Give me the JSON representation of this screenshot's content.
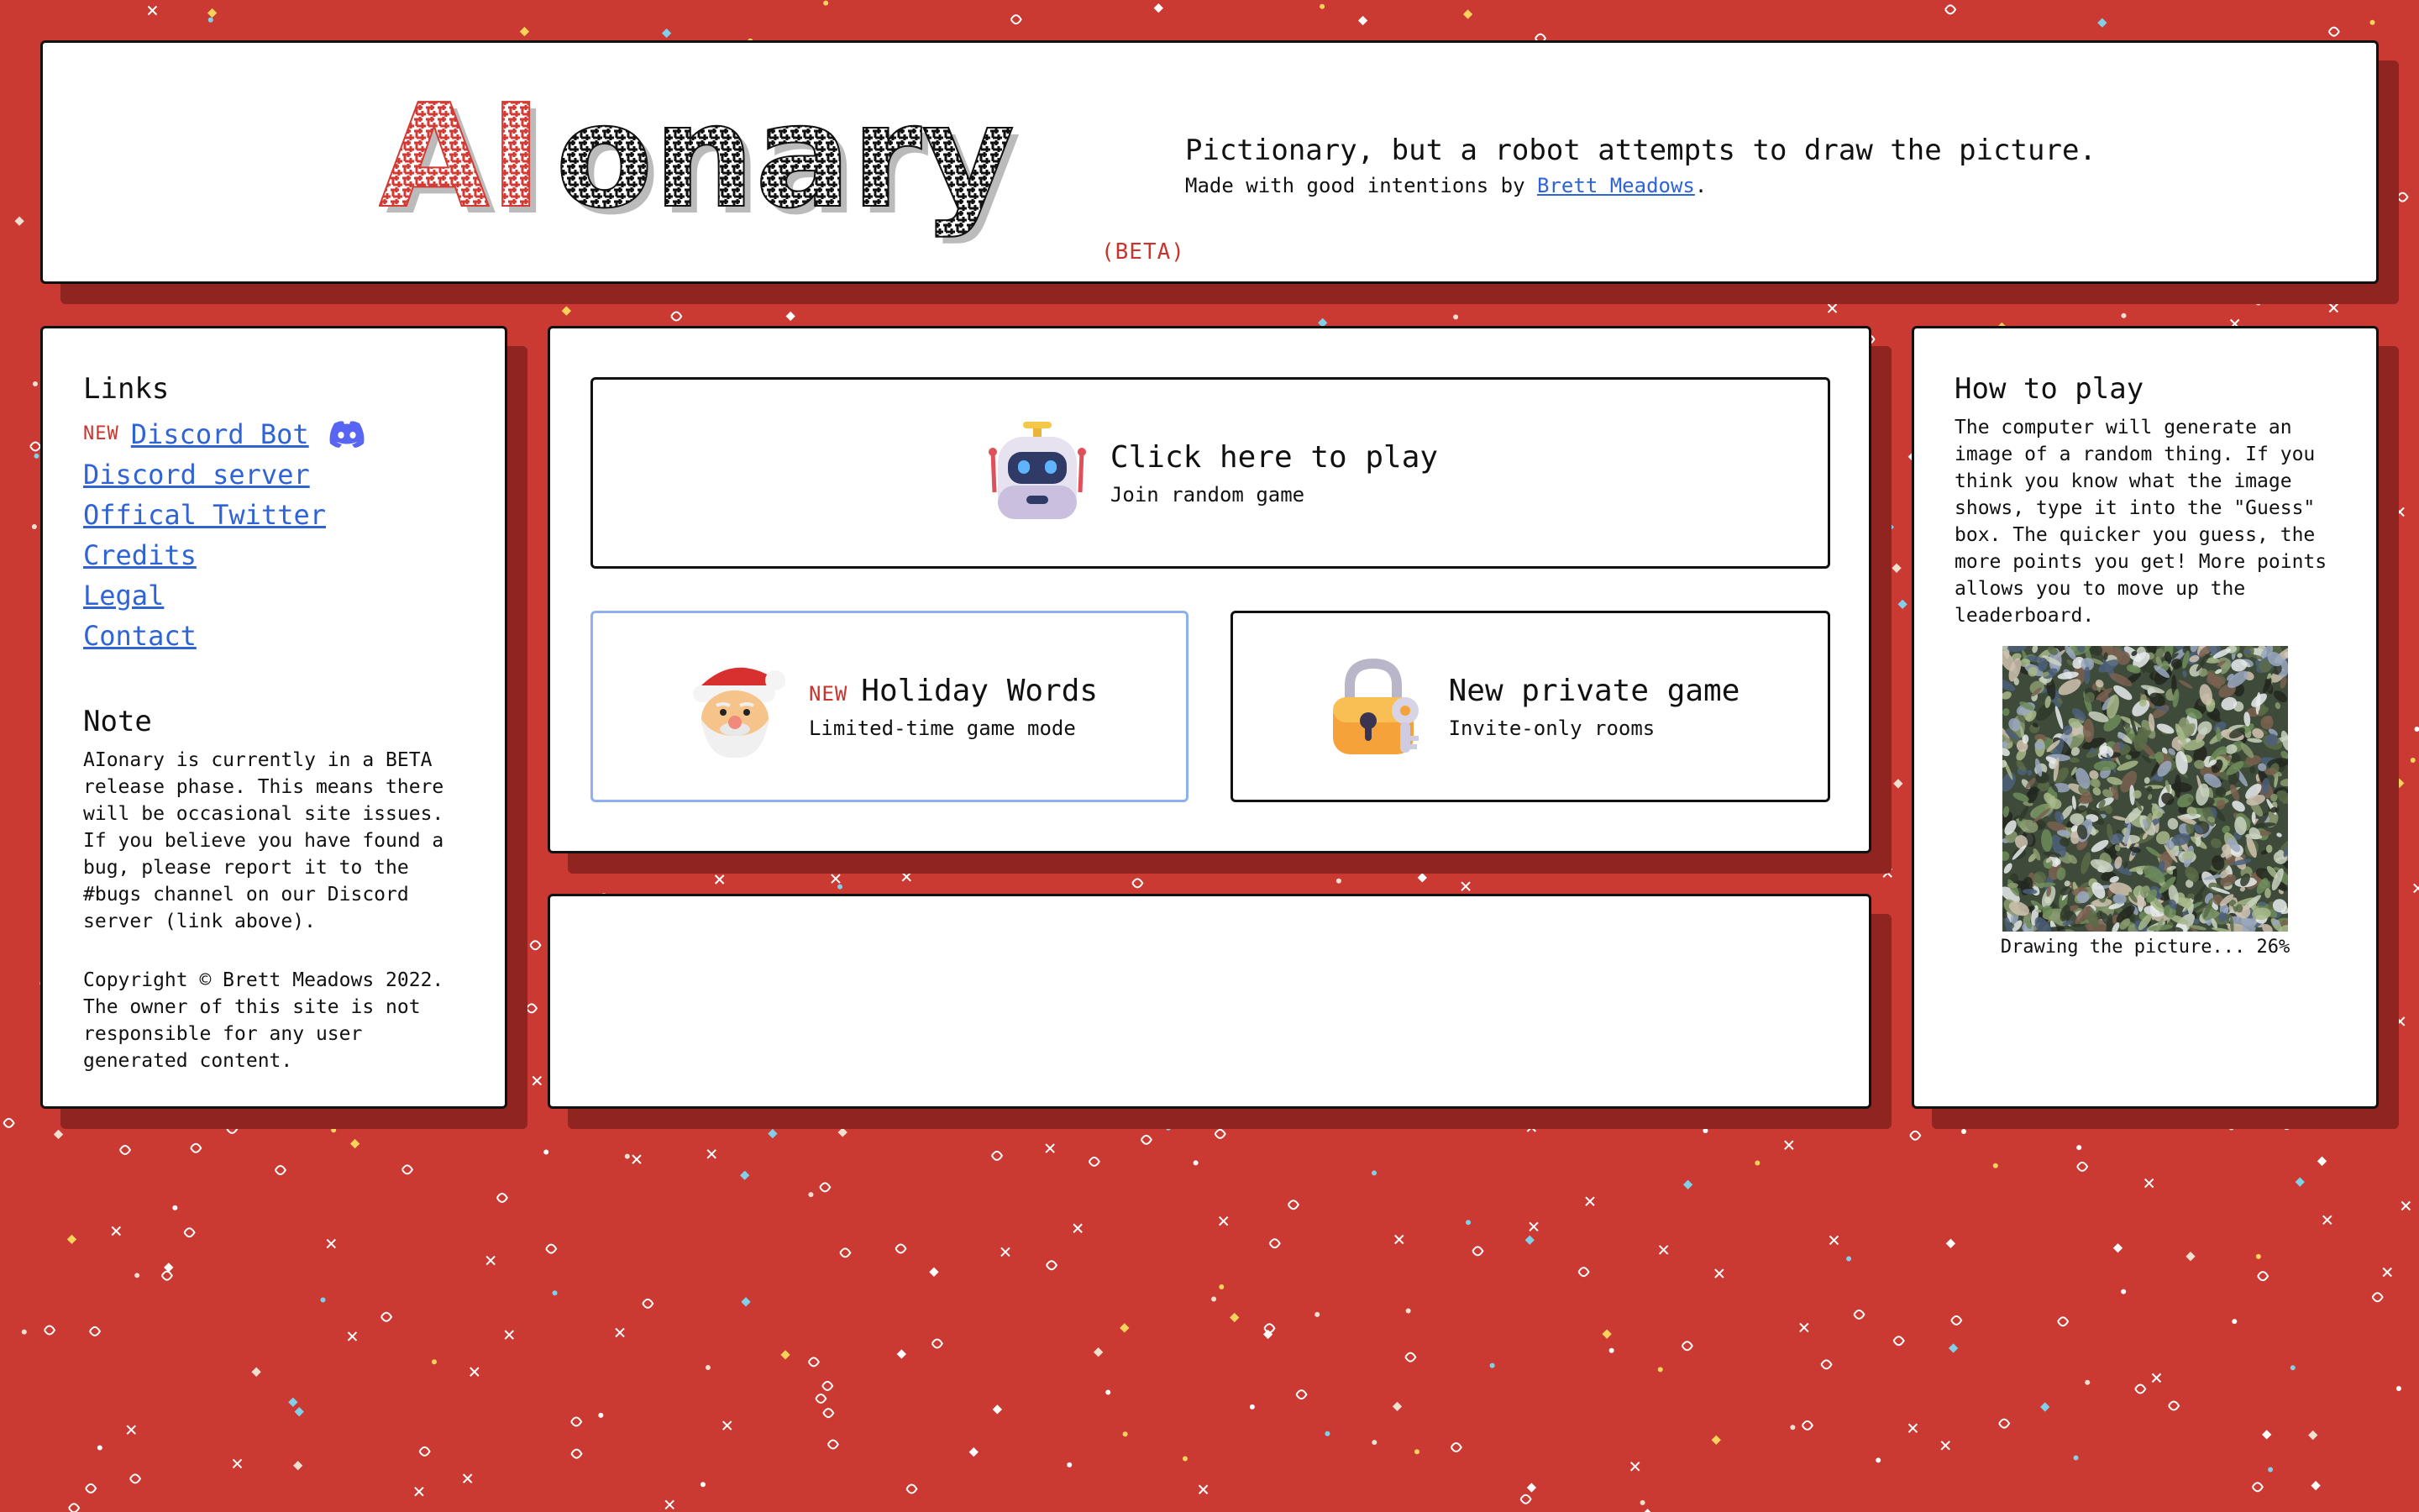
{
  "header": {
    "logo_text": "AIonary",
    "beta_label": "(BETA)",
    "tagline": "Pictionary, but a robot attempts to draw the picture.",
    "madeby_prefix": "Made with good intentions by ",
    "author_link": "Brett Meadows",
    "madeby_suffix": "."
  },
  "links": {
    "title": "Links",
    "new_tag": "NEW",
    "items": [
      {
        "label": "Discord Bot"
      },
      {
        "label": "Discord server"
      },
      {
        "label": "Offical Twitter"
      },
      {
        "label": "Credits"
      },
      {
        "label": "Legal"
      },
      {
        "label": "Contact"
      }
    ]
  },
  "note": {
    "title": "Note",
    "body": "AIonary is currently in a BETA\nrelease phase. This means there\nwill be occasional site issues.\nIf you believe you have found a\nbug, please report it to the\n#bugs channel on our Discord\nserver (link above).",
    "copyright": "Copyright © Brett Meadows 2022.\nThe owner of this site is not\nresponsible for any user\ngenerated content."
  },
  "cards": {
    "play": {
      "title": "Click here to play",
      "subtitle": "Join random game",
      "icon": "robot-icon"
    },
    "holiday": {
      "new_tag": "NEW",
      "title": "Holiday Words",
      "subtitle": "Limited-time game mode",
      "icon": "santa-icon"
    },
    "private": {
      "title": "New private game",
      "subtitle": "Invite-only rooms",
      "icon": "lock-key-icon"
    }
  },
  "howto": {
    "title": "How to play",
    "body": "The computer will generate an image of a random thing. If you think you know what the image shows, type it into the \"Guess\" box. The quicker you guess, the more points you get! More points allows you to move up the leaderboard.",
    "caption": "Drawing the picture... 26%",
    "progress": 0.26
  },
  "colors": {
    "background": "#ca3a33",
    "accent": "#c9342f",
    "link": "#2f64d6",
    "shadow": "#8f2420"
  }
}
